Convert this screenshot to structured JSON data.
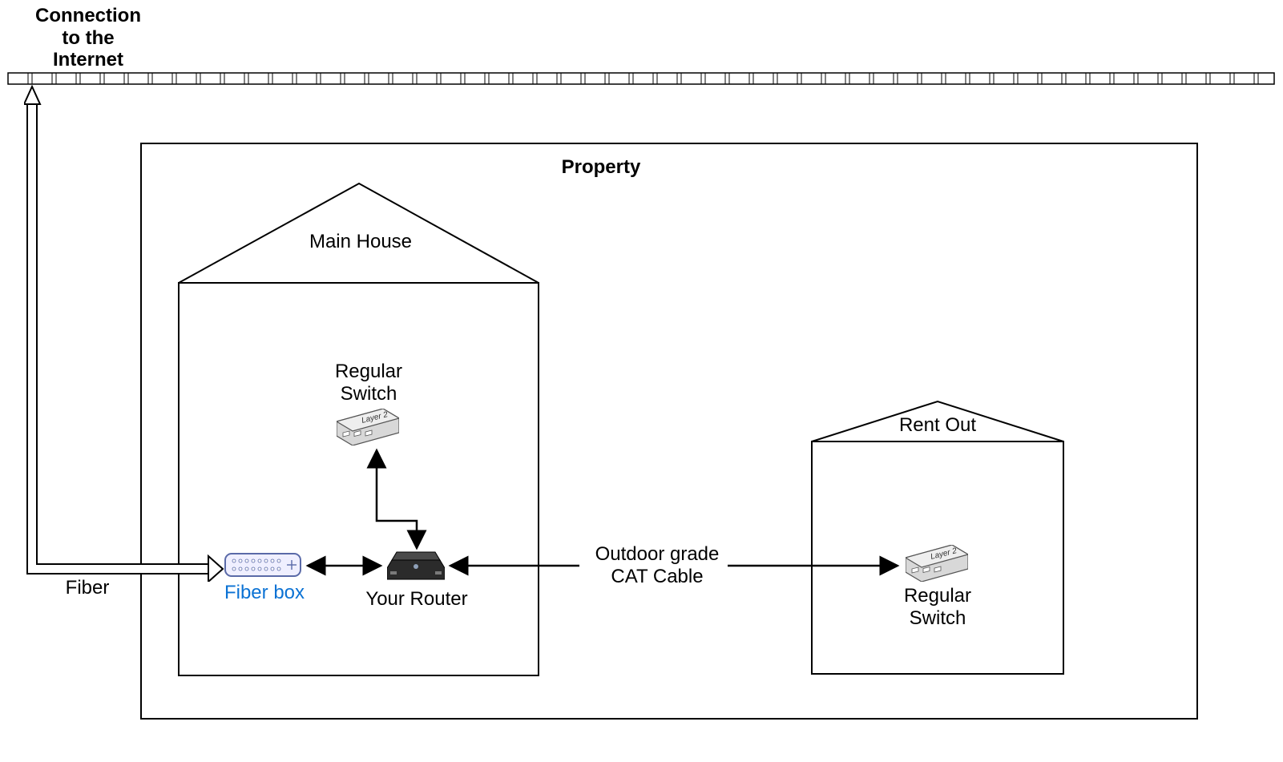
{
  "title": {
    "line1": "Connection",
    "line2": "to the",
    "line3": "Internet"
  },
  "property_label": "Property",
  "main_house_label": "Main House",
  "rent_out_label": "Rent Out",
  "fiber_label": "Fiber",
  "fiber_box_label": "Fiber box",
  "router_label": "Your Router",
  "regular_switch_label_line1": "Regular",
  "regular_switch_label_line2": "Switch",
  "cat_cable_line1": "Outdoor grade",
  "cat_cable_line2": "CAT Cable",
  "layer2_text": "Layer 2"
}
